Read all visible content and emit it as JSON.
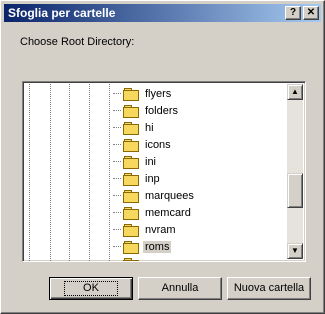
{
  "window": {
    "title": "Sfoglia per cartelle",
    "help_glyph": "?",
    "close_glyph": "✕"
  },
  "prompt": "Choose Root Directory:",
  "tree": {
    "items": [
      {
        "label": "flyers",
        "selected": false
      },
      {
        "label": "folders",
        "selected": false
      },
      {
        "label": "hi",
        "selected": false
      },
      {
        "label": "icons",
        "selected": false
      },
      {
        "label": "ini",
        "selected": false
      },
      {
        "label": "inp",
        "selected": false
      },
      {
        "label": "marquees",
        "selected": false
      },
      {
        "label": "memcard",
        "selected": false
      },
      {
        "label": "nvram",
        "selected": false
      },
      {
        "label": "roms",
        "selected": true
      }
    ],
    "icon": "folder-icon"
  },
  "scrollbar": {
    "up_glyph": "▲",
    "down_glyph": "▼",
    "position_fraction": 0.68,
    "visible_fraction": 0.2
  },
  "buttons": {
    "ok": "OK",
    "cancel": "Annulla",
    "new_folder": "Nuova cartella"
  },
  "colors": {
    "title_start": "#0a246a",
    "title_end": "#a6caf0",
    "face": "#d4d0c8",
    "folder": "#f7d85f"
  }
}
